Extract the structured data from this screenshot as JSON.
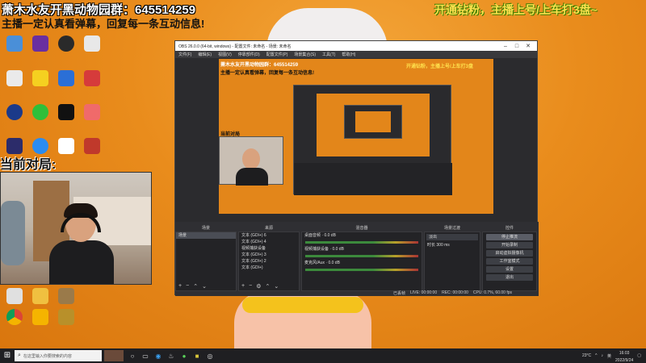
{
  "overlay": {
    "group_text": "萧木水友开黑动物园群：645514259",
    "rule_text": "主播一定认真看弹幕，回复每一条互动信息!",
    "promo_text": "开通钻粉，主播上号/上车打3盘~",
    "match_text": "当前对局:"
  },
  "obs": {
    "title": "OBS 26.0.0 (64-bit, windows) - 配置文件: 未命名 - 场景: 未命名",
    "menu": [
      "文件(F)",
      "编辑(E)",
      "视图(V)",
      "停靠部件(D)",
      "配置文件(P)",
      "场景集合(S)",
      "工具(T)",
      "帮助(H)"
    ],
    "preview_group_text": "萧木水友开黑动物园群：645514259",
    "preview_rule_text": "主播一定认真看弹幕，回复每一条互动信息!",
    "preview_promo_text": "开通钻粉，主播上号/上车打3盘",
    "preview_match_text": "当前对局",
    "docks": {
      "scenes_header": "场景",
      "sources_header": "来源",
      "mixer_header": "混音器",
      "transitions_header": "场景过渡",
      "controls_header": "控件",
      "scene_name": "场景",
      "sources": [
        "文本 (GDI+) 6",
        "文本 (GDI+) 4",
        "视频捕获设备",
        "文本 (GDI+) 3",
        "文本 (GDI+) 2",
        "文本 (GDI+)"
      ],
      "mixer_channels": [
        {
          "name": "桌面音频",
          "level": "0.0 dB"
        },
        {
          "name": "视频捕获设备",
          "level": "0.0 dB"
        },
        {
          "name": "麦克风/Aux",
          "level": "0.0 dB"
        }
      ],
      "transition_type": "淡出",
      "duration_label": "时长",
      "duration_value": "300 ms",
      "controls": [
        "停止推流",
        "开始录制",
        "启动虚拟摄像机",
        "工作室模式",
        "设置",
        "退出"
      ]
    },
    "status": {
      "live": "LIVE: 00:00:00",
      "rec": "REC: 00:00:00",
      "cpu": "CPU: 0.7%, 60.00 fps",
      "frames": "已丢帧"
    }
  },
  "taskbar": {
    "search_placeholder": "在这里输入你要搜索的内容",
    "temperature": "23°C",
    "lang": "英",
    "time": "16:03",
    "date": "2022/9/24"
  },
  "desktop_icon_colors": [
    "#2b6fd6",
    "#3da4f0",
    "#1d1d1d",
    "#2e8b57",
    "#c0392b",
    "#7b3fa0",
    "#e67e22",
    "#1abc9c"
  ]
}
